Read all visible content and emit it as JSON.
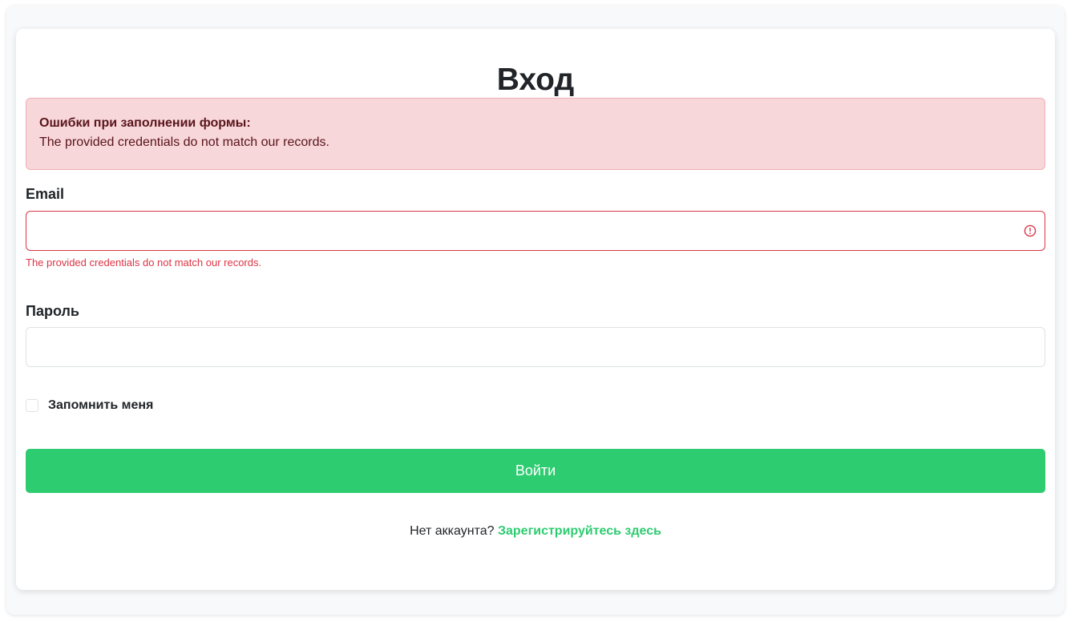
{
  "page": {
    "title": "Вход"
  },
  "alert": {
    "heading": "Ошибки при заполнении формы:",
    "message": "The provided credentials do not match our records."
  },
  "email": {
    "label": "Email",
    "value": "",
    "placeholder": "",
    "error": "The provided credentials do not match our records.",
    "icon": "exclamation-circle-icon"
  },
  "password": {
    "label": "Пароль",
    "value": "",
    "placeholder": ""
  },
  "remember": {
    "label": "Запомнить меня",
    "checked": false
  },
  "submit": {
    "label": "Войти"
  },
  "footer": {
    "text": "Нет аккаунта?",
    "link_label": "Зарегистрируйтесь здесь"
  },
  "colors": {
    "accent": "#2ecc71",
    "danger": "#dc3545",
    "alert_bg": "#f8d7da"
  }
}
